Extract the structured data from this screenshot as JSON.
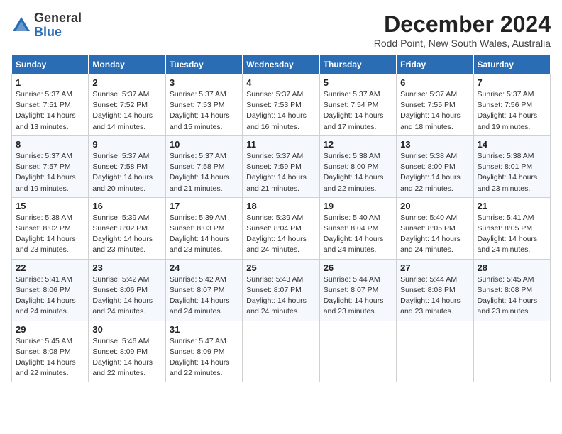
{
  "logo": {
    "general": "General",
    "blue": "Blue"
  },
  "title": "December 2024",
  "subtitle": "Rodd Point, New South Wales, Australia",
  "days_of_week": [
    "Sunday",
    "Monday",
    "Tuesday",
    "Wednesday",
    "Thursday",
    "Friday",
    "Saturday"
  ],
  "weeks": [
    [
      {
        "day": "1",
        "info": "Sunrise: 5:37 AM\nSunset: 7:51 PM\nDaylight: 14 hours\nand 13 minutes."
      },
      {
        "day": "2",
        "info": "Sunrise: 5:37 AM\nSunset: 7:52 PM\nDaylight: 14 hours\nand 14 minutes."
      },
      {
        "day": "3",
        "info": "Sunrise: 5:37 AM\nSunset: 7:53 PM\nDaylight: 14 hours\nand 15 minutes."
      },
      {
        "day": "4",
        "info": "Sunrise: 5:37 AM\nSunset: 7:53 PM\nDaylight: 14 hours\nand 16 minutes."
      },
      {
        "day": "5",
        "info": "Sunrise: 5:37 AM\nSunset: 7:54 PM\nDaylight: 14 hours\nand 17 minutes."
      },
      {
        "day": "6",
        "info": "Sunrise: 5:37 AM\nSunset: 7:55 PM\nDaylight: 14 hours\nand 18 minutes."
      },
      {
        "day": "7",
        "info": "Sunrise: 5:37 AM\nSunset: 7:56 PM\nDaylight: 14 hours\nand 19 minutes."
      }
    ],
    [
      {
        "day": "8",
        "info": "Sunrise: 5:37 AM\nSunset: 7:57 PM\nDaylight: 14 hours\nand 19 minutes."
      },
      {
        "day": "9",
        "info": "Sunrise: 5:37 AM\nSunset: 7:58 PM\nDaylight: 14 hours\nand 20 minutes."
      },
      {
        "day": "10",
        "info": "Sunrise: 5:37 AM\nSunset: 7:58 PM\nDaylight: 14 hours\nand 21 minutes."
      },
      {
        "day": "11",
        "info": "Sunrise: 5:37 AM\nSunset: 7:59 PM\nDaylight: 14 hours\nand 21 minutes."
      },
      {
        "day": "12",
        "info": "Sunrise: 5:38 AM\nSunset: 8:00 PM\nDaylight: 14 hours\nand 22 minutes."
      },
      {
        "day": "13",
        "info": "Sunrise: 5:38 AM\nSunset: 8:00 PM\nDaylight: 14 hours\nand 22 minutes."
      },
      {
        "day": "14",
        "info": "Sunrise: 5:38 AM\nSunset: 8:01 PM\nDaylight: 14 hours\nand 23 minutes."
      }
    ],
    [
      {
        "day": "15",
        "info": "Sunrise: 5:38 AM\nSunset: 8:02 PM\nDaylight: 14 hours\nand 23 minutes."
      },
      {
        "day": "16",
        "info": "Sunrise: 5:39 AM\nSunset: 8:02 PM\nDaylight: 14 hours\nand 23 minutes."
      },
      {
        "day": "17",
        "info": "Sunrise: 5:39 AM\nSunset: 8:03 PM\nDaylight: 14 hours\nand 23 minutes."
      },
      {
        "day": "18",
        "info": "Sunrise: 5:39 AM\nSunset: 8:04 PM\nDaylight: 14 hours\nand 24 minutes."
      },
      {
        "day": "19",
        "info": "Sunrise: 5:40 AM\nSunset: 8:04 PM\nDaylight: 14 hours\nand 24 minutes."
      },
      {
        "day": "20",
        "info": "Sunrise: 5:40 AM\nSunset: 8:05 PM\nDaylight: 14 hours\nand 24 minutes."
      },
      {
        "day": "21",
        "info": "Sunrise: 5:41 AM\nSunset: 8:05 PM\nDaylight: 14 hours\nand 24 minutes."
      }
    ],
    [
      {
        "day": "22",
        "info": "Sunrise: 5:41 AM\nSunset: 8:06 PM\nDaylight: 14 hours\nand 24 minutes."
      },
      {
        "day": "23",
        "info": "Sunrise: 5:42 AM\nSunset: 8:06 PM\nDaylight: 14 hours\nand 24 minutes."
      },
      {
        "day": "24",
        "info": "Sunrise: 5:42 AM\nSunset: 8:07 PM\nDaylight: 14 hours\nand 24 minutes."
      },
      {
        "day": "25",
        "info": "Sunrise: 5:43 AM\nSunset: 8:07 PM\nDaylight: 14 hours\nand 24 minutes."
      },
      {
        "day": "26",
        "info": "Sunrise: 5:44 AM\nSunset: 8:07 PM\nDaylight: 14 hours\nand 23 minutes."
      },
      {
        "day": "27",
        "info": "Sunrise: 5:44 AM\nSunset: 8:08 PM\nDaylight: 14 hours\nand 23 minutes."
      },
      {
        "day": "28",
        "info": "Sunrise: 5:45 AM\nSunset: 8:08 PM\nDaylight: 14 hours\nand 23 minutes."
      }
    ],
    [
      {
        "day": "29",
        "info": "Sunrise: 5:45 AM\nSunset: 8:08 PM\nDaylight: 14 hours\nand 22 minutes."
      },
      {
        "day": "30",
        "info": "Sunrise: 5:46 AM\nSunset: 8:09 PM\nDaylight: 14 hours\nand 22 minutes."
      },
      {
        "day": "31",
        "info": "Sunrise: 5:47 AM\nSunset: 8:09 PM\nDaylight: 14 hours\nand 22 minutes."
      },
      null,
      null,
      null,
      null
    ]
  ]
}
